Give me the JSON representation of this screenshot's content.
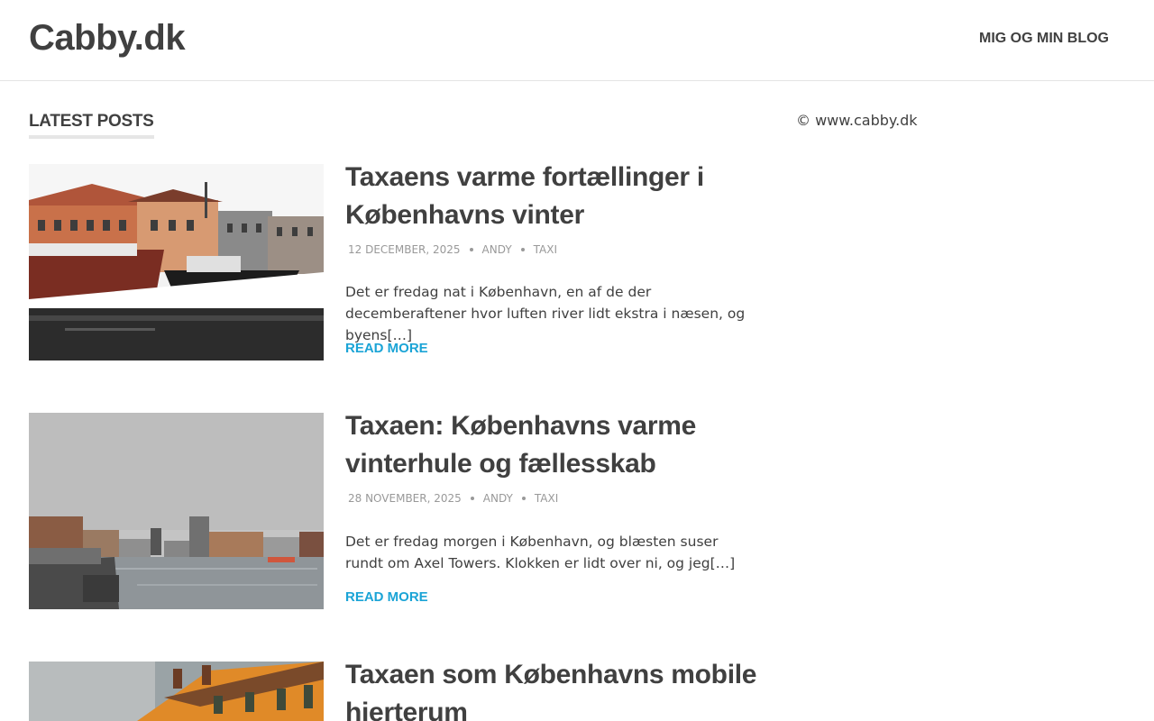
{
  "header": {
    "site_title": "Cabby.dk",
    "nav": [
      {
        "label": "MIG OG MIN BLOG"
      }
    ]
  },
  "main": {
    "section_title": "LATEST POSTS",
    "posts": [
      {
        "title": "Taxaens varme fortællinger i Københavns vinter",
        "date": "12 DECEMBER, 2025",
        "author": "ANDY",
        "category": "TAXI",
        "excerpt": "Det er fredag nat i København, en af de der decemberaftener hvor luften river lidt ekstra i næsen, og byens[…]",
        "read_more": "READ MORE"
      },
      {
        "title": "Taxaen: Københavns varme vinterhule og fællesskab",
        "date": "28 NOVEMBER, 2025",
        "author": "ANDY",
        "category": "TAXI",
        "excerpt": "Det er fredag morgen i København, og blæsten suser rundt om Axel Towers. Klokken er lidt over ni, og jeg[…]",
        "read_more": "READ MORE"
      },
      {
        "title": "Taxaen som Københavns mobile hjerterum"
      }
    ]
  },
  "sidebar": {
    "copyright": "© www.cabby.dk"
  },
  "colors": {
    "text": "#404040",
    "meta": "#999999",
    "link_accent": "#1ba4d6",
    "divider": "#e4e4e4"
  }
}
